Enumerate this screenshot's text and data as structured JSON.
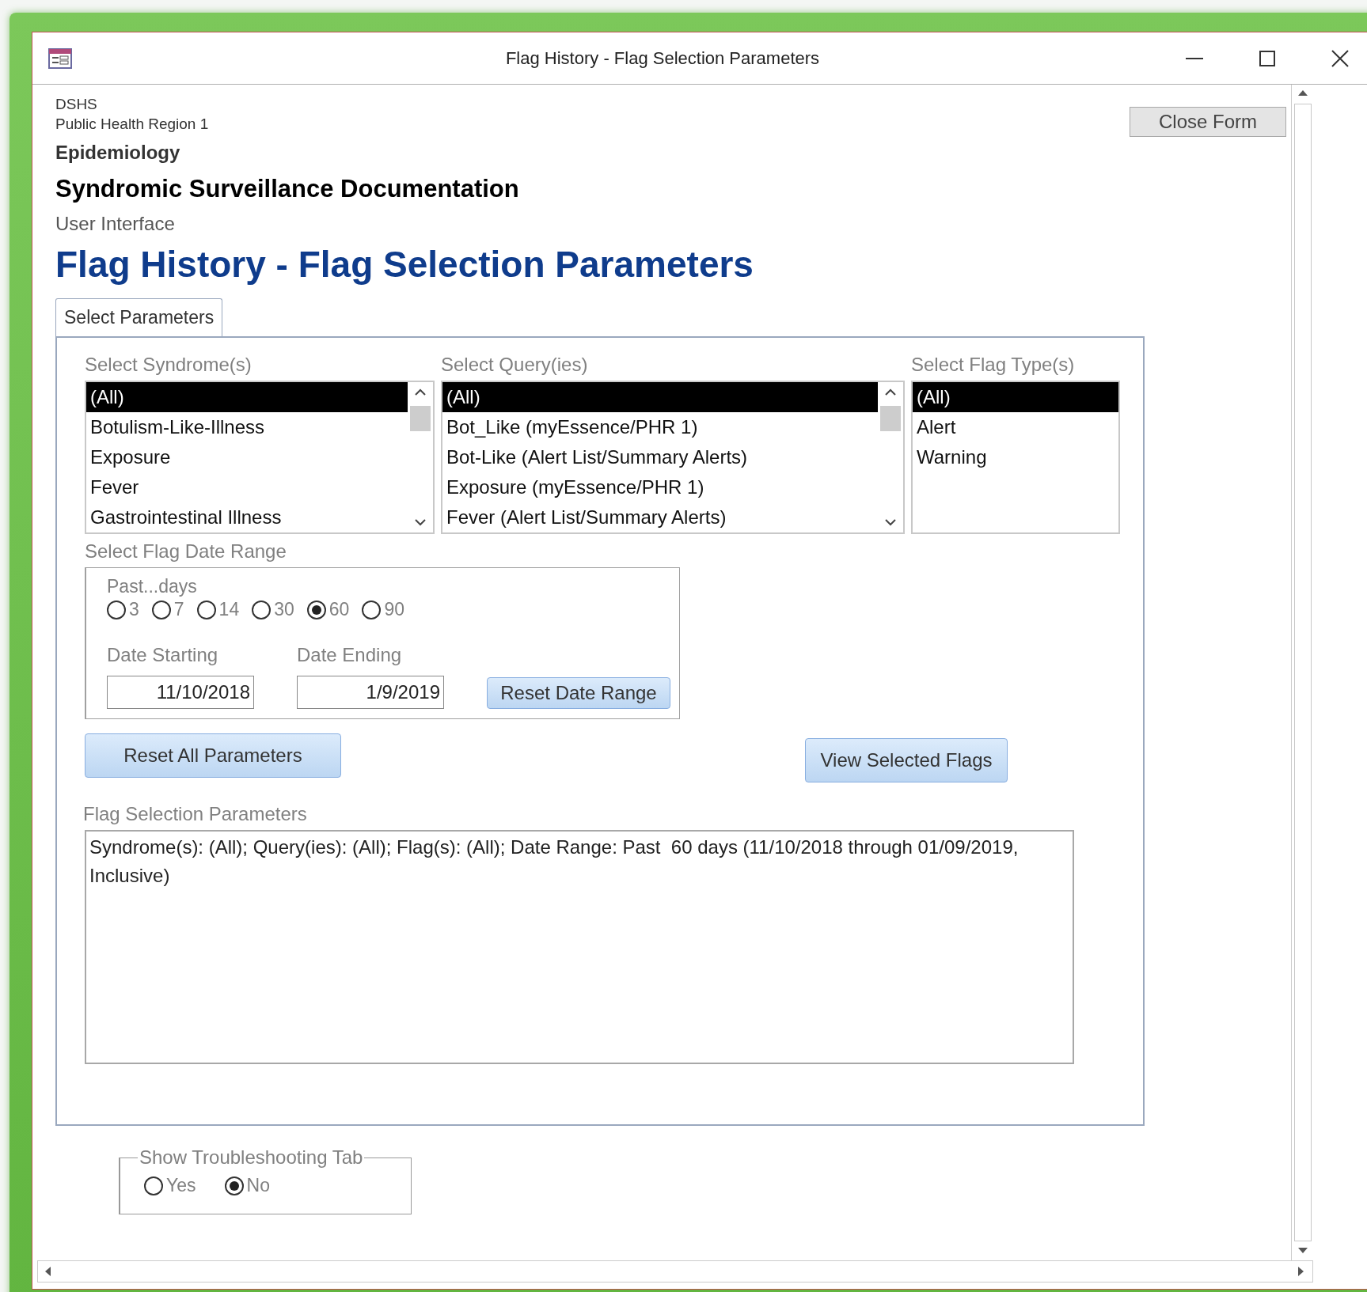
{
  "window": {
    "title": "Flag History - Flag Selection Parameters"
  },
  "header": {
    "org": "DSHS",
    "region": "Public Health Region 1",
    "department": "Epidemiology",
    "system": "Syndromic Surveillance Documentation",
    "section": "User Interface",
    "title": "Flag History - Flag Selection Parameters"
  },
  "close_button": "Close Form",
  "tabs": [
    {
      "label": "Select Parameters",
      "selected": true
    }
  ],
  "lists": [
    {
      "label": "Select Syndrome(s)",
      "scrollable": true,
      "items": [
        {
          "text": "(All)",
          "selected": true
        },
        {
          "text": "Botulism-Like-Illness",
          "selected": false
        },
        {
          "text": "Exposure",
          "selected": false
        },
        {
          "text": "Fever",
          "selected": false
        },
        {
          "text": "Gastrointestinal Illness",
          "selected": false
        }
      ]
    },
    {
      "label": "Select Query(ies)",
      "scrollable": true,
      "items": [
        {
          "text": "(All)",
          "selected": true
        },
        {
          "text": "Bot_Like (myEssence/PHR 1)",
          "selected": false
        },
        {
          "text": "Bot-Like (Alert List/Summary Alerts)",
          "selected": false
        },
        {
          "text": "Exposure (myEssence/PHR 1)",
          "selected": false
        },
        {
          "text": "Fever (Alert List/Summary Alerts)",
          "selected": false
        }
      ]
    },
    {
      "label": "Select Flag Type(s)",
      "scrollable": false,
      "items": [
        {
          "text": "(All)",
          "selected": true
        },
        {
          "text": "Alert",
          "selected": false
        },
        {
          "text": "Warning",
          "selected": false
        }
      ]
    }
  ],
  "date_range": {
    "label": "Select Flag Date Range",
    "past_days_label": "Past...days",
    "options": [
      {
        "label": "3",
        "selected": false
      },
      {
        "label": "7",
        "selected": false
      },
      {
        "label": "14",
        "selected": false
      },
      {
        "label": "30",
        "selected": false
      },
      {
        "label": "60",
        "selected": true
      },
      {
        "label": "90",
        "selected": false
      }
    ],
    "start_label": "Date Starting",
    "start_value": "11/10/2018",
    "end_label": "Date Ending",
    "end_value": "1/9/2019",
    "reset_button": "Reset Date Range"
  },
  "reset_all_button": "Reset All Parameters",
  "view_button": "View Selected Flags",
  "summary": {
    "label": "Flag Selection Parameters",
    "value": "Syndrome(s): (All); Query(ies): (All); Flag(s): (All); Date Range: Past  60 days (11/10/2018 through 01/09/2019, Inclusive)"
  },
  "troubleshooting": {
    "label": "Show Troubleshooting Tab",
    "options": [
      {
        "label": "Yes",
        "selected": false
      },
      {
        "label": "No",
        "selected": true
      }
    ]
  }
}
